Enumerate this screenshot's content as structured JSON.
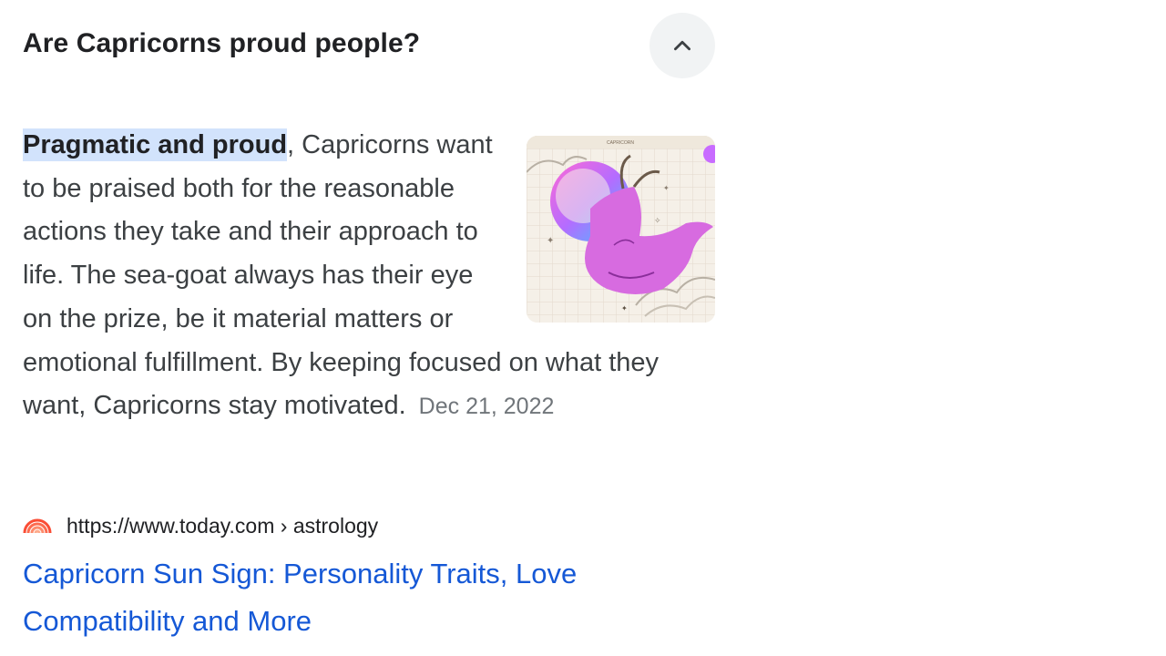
{
  "question": {
    "text": "Are Capricorns proud people?",
    "toggle_icon": "chevron-up-icon"
  },
  "answer": {
    "highlight": "Pragmatic and proud",
    "body": ", Capricorns want to be praised both for the reasonable actions they take and their approach to life. The sea-goat always has their eye on the prize, be it material matters or emotional fulfillment. By keeping focused on what they want, Capricorns stay motivated.",
    "date": "Dec 21, 2022",
    "image_icon": "capricorn-illustration",
    "image_caption": "CAPRICORN"
  },
  "source": {
    "favicon": "today-rainbow-icon",
    "url": "https://www.today.com › astrology"
  },
  "result": {
    "title": "Capricorn Sun Sign: Personality Traits, Love Compatibility and More"
  },
  "colors": {
    "link": "#1558d6",
    "highlight_bg": "#d2e3fc",
    "button_bg": "#f1f3f4",
    "body_text": "#3c4043"
  }
}
